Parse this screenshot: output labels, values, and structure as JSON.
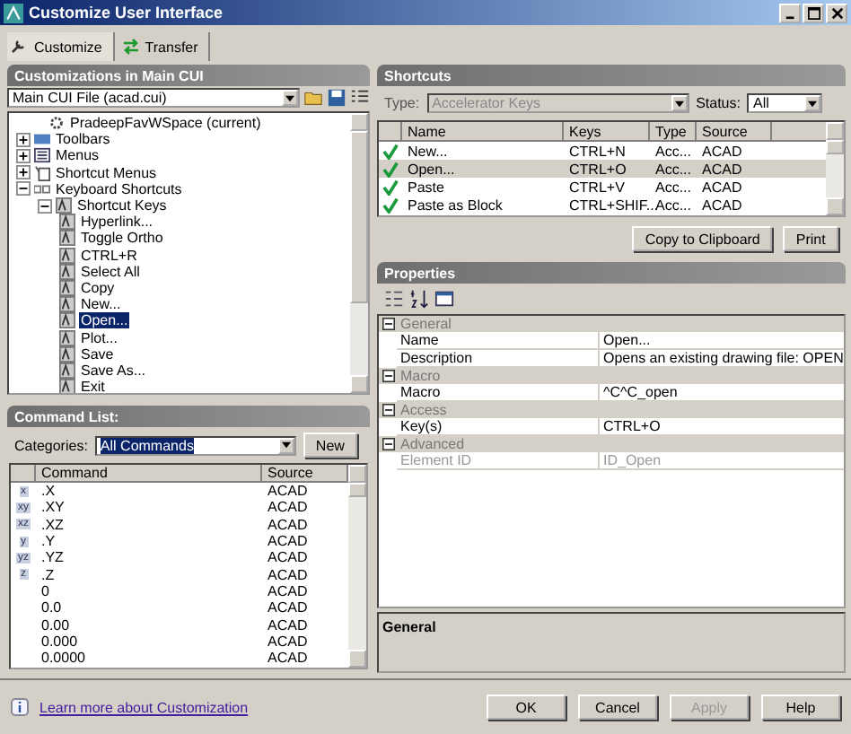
{
  "window": {
    "title": "Customize User Interface"
  },
  "tabs": [
    {
      "label": "Customize",
      "selected": true
    },
    {
      "label": "Transfer",
      "selected": false
    }
  ],
  "customizations": {
    "header": "Customizations in Main CUI",
    "file": "Main CUI File (acad.cui)",
    "tree": [
      {
        "label": "PradeepFavWSpace (current)",
        "kind": "workspace",
        "selected": false
      },
      {
        "label": "Toolbars",
        "kind": "toolbars",
        "expanded": false,
        "selected": false
      },
      {
        "label": "Menus",
        "kind": "menus",
        "expanded": false,
        "selected": false
      },
      {
        "label": "Shortcut Menus",
        "kind": "shortcut-menus",
        "expanded": false,
        "selected": false
      },
      {
        "label": "Keyboard Shortcuts",
        "kind": "keyboard",
        "expanded": true,
        "selected": false,
        "children": [
          {
            "label": "Shortcut Keys",
            "kind": "key",
            "expanded": true,
            "selected": false,
            "children": [
              {
                "label": "Hyperlink...",
                "kind": "key",
                "selected": false
              },
              {
                "label": "Toggle Ortho",
                "kind": "key",
                "selected": false
              },
              {
                "label": "CTRL+R",
                "kind": "key",
                "selected": false
              },
              {
                "label": "Select All",
                "kind": "key",
                "selected": false
              },
              {
                "label": "Copy",
                "kind": "key",
                "selected": false
              },
              {
                "label": "New...",
                "kind": "key",
                "selected": false
              },
              {
                "label": "Open...",
                "kind": "key",
                "selected": true
              },
              {
                "label": "Plot...",
                "kind": "key",
                "selected": false
              },
              {
                "label": "Save",
                "kind": "key",
                "selected": false
              },
              {
                "label": "Save As...",
                "kind": "key",
                "selected": false
              },
              {
                "label": "Exit",
                "kind": "key",
                "selected": false
              }
            ]
          }
        ]
      }
    ]
  },
  "command_list": {
    "header": "Command List:",
    "categories_label": "Categories:",
    "category": "All Commands",
    "new_button": "New",
    "columns": [
      "Command",
      "Source"
    ],
    "rows": [
      {
        "icon": "x",
        "command": ".X",
        "source": "ACAD"
      },
      {
        "icon": "xy",
        "command": ".XY",
        "source": "ACAD"
      },
      {
        "icon": "xz",
        "command": ".XZ",
        "source": "ACAD"
      },
      {
        "icon": "y",
        "command": ".Y",
        "source": "ACAD"
      },
      {
        "icon": "yz",
        "command": ".YZ",
        "source": "ACAD"
      },
      {
        "icon": "z",
        "command": ".Z",
        "source": "ACAD"
      },
      {
        "command": "0",
        "source": "ACAD"
      },
      {
        "command": "0.0",
        "source": "ACAD"
      },
      {
        "command": "0.00",
        "source": "ACAD"
      },
      {
        "command": "0.000",
        "source": "ACAD"
      },
      {
        "command": "0.0000",
        "source": "ACAD"
      }
    ]
  },
  "shortcuts": {
    "header": "Shortcuts",
    "type_label": "Type:",
    "type": "Accelerator Keys",
    "type_disabled": true,
    "status_label": "Status:",
    "status": "All",
    "columns": [
      "Name",
      "Keys",
      "Type",
      "Source"
    ],
    "rows": [
      {
        "name": "New...",
        "keys": "CTRL+N",
        "type": "Acc...",
        "source": "ACAD",
        "selected": false
      },
      {
        "name": "Open...",
        "keys": "CTRL+O",
        "type": "Acc...",
        "source": "ACAD",
        "selected": true
      },
      {
        "name": "Paste",
        "keys": "CTRL+V",
        "type": "Acc...",
        "source": "ACAD",
        "selected": false
      },
      {
        "name": "Paste as Block",
        "keys": "CTRL+SHIF...",
        "type": "Acc...",
        "source": "ACAD",
        "selected": false
      }
    ],
    "buttons": [
      "Copy to Clipboard",
      "Print"
    ]
  },
  "properties": {
    "header": "Properties",
    "groups": [
      {
        "name": "General",
        "expanded": true,
        "rows": [
          {
            "name": "Name",
            "value": "Open...",
            "disabled": false
          },
          {
            "name": "Description",
            "value": "Opens an existing drawing file:  OPEN",
            "disabled": false
          }
        ]
      },
      {
        "name": "Macro",
        "expanded": true,
        "rows": [
          {
            "name": "Macro",
            "value": "^C^C_open",
            "disabled": false
          }
        ]
      },
      {
        "name": "Access",
        "expanded": true,
        "rows": [
          {
            "name": "Key(s)",
            "value": "CTRL+O",
            "disabled": false
          }
        ]
      },
      {
        "name": "Advanced",
        "expanded": true,
        "rows": [
          {
            "name": "Element ID",
            "value": "ID_Open",
            "disabled": true
          }
        ]
      }
    ],
    "description_title": "General"
  },
  "footer": {
    "link": "Learn more about Customization",
    "buttons": [
      {
        "label": "OK",
        "disabled": false
      },
      {
        "label": "Cancel",
        "disabled": false
      },
      {
        "label": "Apply",
        "disabled": true
      },
      {
        "label": "Help",
        "disabled": false
      }
    ]
  }
}
